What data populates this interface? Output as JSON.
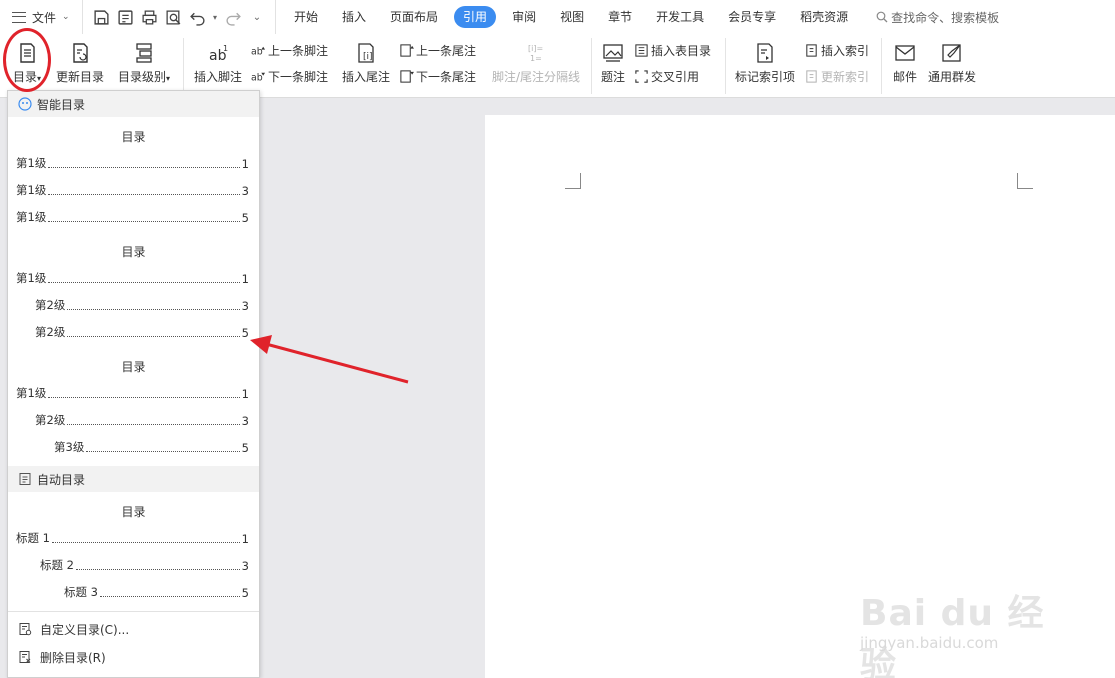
{
  "menubar": {
    "file_label": "文件",
    "tabs": [
      "开始",
      "插入",
      "页面布局",
      "引用",
      "审阅",
      "视图",
      "章节",
      "开发工具",
      "会员专享",
      "稻壳资源"
    ],
    "active_tab": "引用",
    "search_label": "查找命令、搜索模板"
  },
  "ribbon": {
    "toc_label": "目录",
    "update_toc_label": "更新目录",
    "toc_level_label": "目录级别",
    "insert_footnote_label": "插入脚注",
    "prev_footnote_label": "上一条脚注",
    "next_footnote_label": "下一条脚注",
    "insert_endnote_label": "插入尾注",
    "prev_endnote_label": "上一条尾注",
    "next_endnote_label": "下一条尾注",
    "separator_label": "脚注/尾注分隔线",
    "caption_label": "题注",
    "insert_table_of_figures_label": "插入表目录",
    "cross_reference_label": "交叉引用",
    "mark_index_label": "标记索引项",
    "insert_index_label": "插入索引",
    "update_index_label": "更新索引",
    "mail_label": "邮件",
    "mass_send_label": "通用群发"
  },
  "dropdown": {
    "smart_toc_header": "智能目录",
    "auto_toc_header": "自动目录",
    "toc_title": "目录",
    "preset1": [
      {
        "text": "第1级",
        "page": "1"
      },
      {
        "text": "第1级",
        "page": "3"
      },
      {
        "text": "第1级",
        "page": "5"
      }
    ],
    "preset2": [
      {
        "text": "第1级",
        "page": "1"
      },
      {
        "text": "第2级",
        "page": "3"
      },
      {
        "text": "第2级",
        "page": "5"
      }
    ],
    "preset3": [
      {
        "text": "第1级",
        "page": "1"
      },
      {
        "text": "第2级",
        "page": "3"
      },
      {
        "text": "第3级",
        "page": "5"
      }
    ],
    "auto": [
      {
        "text": "标题 1",
        "page": "1"
      },
      {
        "text": "标题 2",
        "page": "3"
      },
      {
        "text": "标题 3",
        "page": "5"
      }
    ],
    "custom_toc_label": "自定义目录(C)...",
    "delete_toc_label": "删除目录(R)"
  },
  "watermark": {
    "brand": "Bai du 经验",
    "url": "jingyan.baidu.com"
  },
  "colors": {
    "accent": "#3b8cf0",
    "annotation_red": "#e0232b"
  }
}
